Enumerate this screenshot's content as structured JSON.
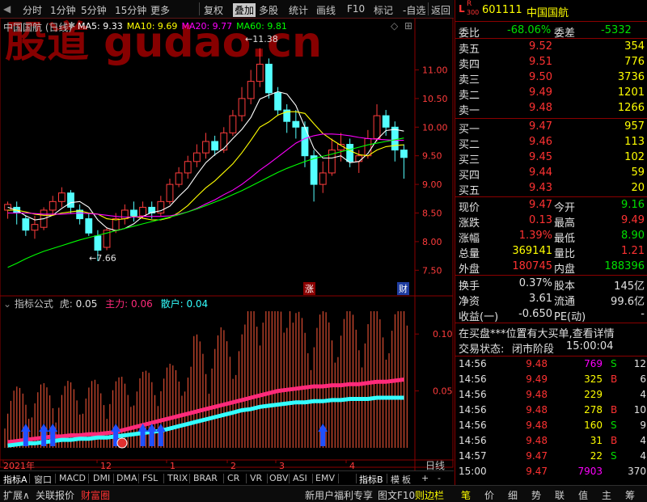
{
  "toolbar": {
    "items": [
      "分时",
      "1分钟",
      "5分钟",
      "15分钟",
      "更多",
      "复权",
      "叠加",
      "多股",
      "统计",
      "画线",
      "F10",
      "标记",
      "-自选",
      "返回"
    ],
    "active": "叠加"
  },
  "main_chart": {
    "title": "中国国航 (日线)",
    "ma": [
      {
        "label": "MA5: 9.33",
        "color": "#ffffff"
      },
      {
        "label": "MA10: 9.69",
        "color": "#ffff00"
      },
      {
        "label": "MA20: 9.77",
        "color": "#ff00ff"
      },
      {
        "label": "MA60: 9.81",
        "color": "#00ff00"
      }
    ],
    "watermark": "股道 gudao.cn",
    "high_label": "11.38",
    "low_label": "7.66",
    "price_ticks": [
      "11.00",
      "10.50",
      "10.00",
      "9.50",
      "9.00",
      "8.50",
      "8.00",
      "7.50"
    ],
    "tag_zhang": "涨",
    "tag_cai": "财"
  },
  "indicator": {
    "title": "指标公式",
    "hu_label": "虎:",
    "hu_value": "0.05",
    "zhuli_label": "主力:",
    "zhuli_value": "0.06",
    "sanhu_label": "散户:",
    "sanhu_value": "0.04",
    "ticks": [
      "0.10",
      "0.05"
    ],
    "colors": {
      "zhuli": "#ff2a7a",
      "sanhu": "#33ffff",
      "bars": "#ff5a3a"
    }
  },
  "chart_data": {
    "type": "line",
    "ylim": [
      7.25,
      11.6
    ],
    "candles": [
      [
        8.55,
        8.65,
        8.4,
        8.7
      ],
      [
        8.6,
        8.5,
        8.3,
        8.7
      ],
      [
        8.4,
        8.2,
        8.1,
        8.45
      ],
      [
        8.2,
        8.3,
        8.05,
        8.45
      ],
      [
        8.25,
        8.55,
        8.2,
        8.6
      ],
      [
        8.55,
        8.7,
        8.45,
        8.8
      ],
      [
        8.7,
        8.85,
        8.6,
        8.95
      ],
      [
        8.85,
        8.6,
        8.5,
        8.9
      ],
      [
        8.55,
        8.4,
        8.3,
        8.65
      ],
      [
        8.4,
        8.15,
        8.1,
        8.5
      ],
      [
        8.1,
        7.85,
        7.66,
        8.2
      ],
      [
        7.9,
        8.2,
        7.85,
        8.25
      ],
      [
        8.2,
        8.4,
        8.15,
        8.5
      ],
      [
        8.4,
        8.55,
        8.3,
        8.65
      ],
      [
        8.55,
        8.45,
        8.35,
        8.7
      ],
      [
        8.45,
        8.6,
        8.4,
        8.7
      ],
      [
        8.6,
        8.5,
        8.4,
        8.7
      ],
      [
        8.5,
        8.7,
        8.45,
        8.8
      ],
      [
        8.7,
        9.0,
        8.65,
        9.1
      ],
      [
        9.0,
        9.2,
        8.95,
        9.3
      ],
      [
        9.2,
        9.4,
        9.1,
        9.5
      ],
      [
        9.4,
        9.55,
        9.3,
        9.7
      ],
      [
        9.55,
        9.75,
        9.45,
        9.9
      ],
      [
        9.75,
        9.6,
        9.5,
        9.85
      ],
      [
        9.6,
        9.9,
        9.55,
        10.0
      ],
      [
        9.9,
        10.2,
        9.85,
        10.3
      ],
      [
        10.2,
        10.5,
        10.1,
        10.7
      ],
      [
        10.5,
        10.8,
        10.4,
        11.0
      ],
      [
        10.8,
        11.1,
        10.7,
        11.38
      ],
      [
        11.1,
        10.6,
        10.5,
        11.2
      ],
      [
        10.6,
        10.3,
        10.2,
        10.7
      ],
      [
        10.3,
        10.1,
        9.9,
        10.4
      ],
      [
        10.1,
        10.0,
        9.8,
        10.3
      ],
      [
        10.0,
        9.5,
        9.3,
        10.1
      ],
      [
        9.5,
        9.0,
        8.7,
        9.6
      ],
      [
        9.0,
        9.2,
        8.85,
        9.4
      ],
      [
        9.2,
        9.6,
        9.15,
        9.8
      ],
      [
        9.6,
        9.7,
        9.4,
        9.9
      ],
      [
        9.7,
        9.4,
        9.3,
        9.8
      ],
      [
        9.4,
        9.5,
        9.2,
        9.6
      ],
      [
        9.5,
        9.8,
        9.45,
        9.95
      ],
      [
        9.8,
        10.2,
        9.75,
        10.4
      ],
      [
        10.2,
        10.0,
        9.85,
        10.3
      ],
      [
        10.0,
        9.6,
        9.4,
        10.1
      ],
      [
        9.6,
        9.47,
        9.1,
        9.7
      ]
    ],
    "ma_series": [
      {
        "name": "MA5",
        "color": "#ffffff",
        "values": [
          8.6,
          8.55,
          8.45,
          8.38,
          8.4,
          8.46,
          8.58,
          8.68,
          8.7,
          8.6,
          8.38,
          8.24,
          8.19,
          8.23,
          8.31,
          8.44,
          8.51,
          8.54,
          8.62,
          8.79,
          8.94,
          9.17,
          9.38,
          9.52,
          9.63,
          9.8,
          9.96,
          10.17,
          10.49,
          10.56,
          10.62,
          10.58,
          10.38,
          10.0,
          9.63,
          9.46,
          9.46,
          9.5,
          9.38,
          9.4,
          9.54,
          9.78,
          9.94,
          9.96,
          9.93
        ]
      },
      {
        "name": "MA10",
        "color": "#ffff00",
        "values": [
          8.55,
          8.55,
          8.52,
          8.48,
          8.46,
          8.46,
          8.5,
          8.52,
          8.54,
          8.5,
          8.48,
          8.4,
          8.38,
          8.4,
          8.44,
          8.41,
          8.38,
          8.38,
          8.42,
          8.51,
          8.63,
          8.79,
          8.94,
          9.06,
          9.21,
          9.36,
          9.55,
          9.77,
          10.0,
          10.09,
          10.21,
          10.27,
          10.27,
          10.24,
          10.06,
          9.89,
          9.78,
          9.68,
          9.59,
          9.52,
          9.5,
          9.6,
          9.66,
          9.68,
          9.69
        ]
      },
      {
        "name": "MA20",
        "color": "#ff00ff",
        "values": [
          8.5,
          8.5,
          8.5,
          8.49,
          8.48,
          8.48,
          8.48,
          8.49,
          8.5,
          8.49,
          8.48,
          8.46,
          8.44,
          8.43,
          8.43,
          8.44,
          8.44,
          8.44,
          8.45,
          8.48,
          8.52,
          8.58,
          8.66,
          8.73,
          8.82,
          8.9,
          9.0,
          9.12,
          9.25,
          9.36,
          9.48,
          9.6,
          9.72,
          9.8,
          9.85,
          9.88,
          9.88,
          9.87,
          9.85,
          9.82,
          9.8,
          9.79,
          9.78,
          9.77,
          9.77
        ]
      },
      {
        "name": "MA60",
        "color": "#00ff00",
        "values": [
          7.55,
          7.62,
          7.7,
          7.77,
          7.83,
          7.88,
          7.93,
          7.98,
          8.03,
          8.07,
          8.11,
          8.15,
          8.19,
          8.23,
          8.27,
          8.31,
          8.35,
          8.39,
          8.43,
          8.47,
          8.52,
          8.57,
          8.63,
          8.69,
          8.75,
          8.82,
          8.89,
          8.97,
          9.05,
          9.13,
          9.21,
          9.28,
          9.34,
          9.4,
          9.45,
          9.49,
          9.53,
          9.57,
          9.61,
          9.65,
          9.69,
          9.72,
          9.75,
          9.78,
          9.81
        ]
      }
    ],
    "indicator_ylim": [
      0,
      0.125
    ],
    "zhuli": [
      0.005,
      0.006,
      0.007,
      0.008,
      0.009,
      0.01,
      0.01,
      0.011,
      0.011,
      0.012,
      0.012,
      0.013,
      0.014,
      0.016,
      0.018,
      0.02,
      0.022,
      0.024,
      0.026,
      0.028,
      0.03,
      0.032,
      0.034,
      0.036,
      0.038,
      0.04,
      0.042,
      0.044,
      0.046,
      0.048,
      0.05,
      0.051,
      0.052,
      0.053,
      0.054,
      0.054,
      0.055,
      0.055,
      0.056,
      0.056,
      0.057,
      0.058,
      0.058,
      0.059,
      0.06
    ],
    "sanhu": [
      0.002,
      0.003,
      0.004,
      0.004,
      0.005,
      0.006,
      0.007,
      0.007,
      0.008,
      0.008,
      0.009,
      0.009,
      0.01,
      0.011,
      0.012,
      0.013,
      0.014,
      0.015,
      0.017,
      0.019,
      0.021,
      0.023,
      0.025,
      0.027,
      0.029,
      0.031,
      0.033,
      0.034,
      0.036,
      0.037,
      0.038,
      0.039,
      0.04,
      0.04,
      0.041,
      0.041,
      0.042,
      0.042,
      0.043,
      0.043,
      0.043,
      0.044,
      0.044,
      0.044,
      0.044
    ],
    "x_labels": [
      "2021年",
      "12",
      "1",
      "2",
      "3",
      "4"
    ],
    "right_label": "日线"
  },
  "bottom_tabs": [
    "指标A",
    "窗口",
    "MACD",
    "DMI",
    "DMA",
    "FSL",
    "TRIX",
    "BRAR",
    "CR",
    "VR",
    "OBV",
    "ASI",
    "EMV",
    "指标B",
    "模",
    "板",
    "+",
    "-"
  ],
  "status_bar": {
    "left": [
      "扩展∧",
      "关联报价",
      "财富圈"
    ],
    "mid": [
      "新用户福利专享",
      "图文F10",
      "则边栏"
    ],
    "right": [
      "笔",
      "价",
      "细",
      "势",
      "联",
      "值",
      "主",
      "筹"
    ]
  },
  "quote": {
    "code": "601111",
    "name": "中国国航",
    "weibi_label": "委比",
    "weibi_value": "-68.06%",
    "weicha_label": "委差",
    "weicha_value": "-5332",
    "asks": [
      {
        "label": "卖五",
        "price": "9.52",
        "vol": "354"
      },
      {
        "label": "卖四",
        "price": "9.51",
        "vol": "776"
      },
      {
        "label": "卖三",
        "price": "9.50",
        "vol": "3736"
      },
      {
        "label": "卖二",
        "price": "9.49",
        "vol": "1201"
      },
      {
        "label": "卖一",
        "price": "9.48",
        "vol": "1266"
      }
    ],
    "bids": [
      {
        "label": "买一",
        "price": "9.47",
        "vol": "957"
      },
      {
        "label": "买二",
        "price": "9.46",
        "vol": "113"
      },
      {
        "label": "买三",
        "price": "9.45",
        "vol": "102"
      },
      {
        "label": "买四",
        "price": "9.44",
        "vol": "59"
      },
      {
        "label": "买五",
        "price": "9.43",
        "vol": "20"
      }
    ],
    "stats": [
      {
        "l1": "现价",
        "v1": "9.47",
        "c1": "#ff3232",
        "l2": "今开",
        "v2": "9.16",
        "c2": "#00e000"
      },
      {
        "l1": "涨跌",
        "v1": "0.13",
        "c1": "#ff3232",
        "l2": "最高",
        "v2": "9.49",
        "c2": "#ff3232"
      },
      {
        "l1": "涨幅",
        "v1": "1.39%",
        "c1": "#ff3232",
        "l2": "最低",
        "v2": "8.90",
        "c2": "#00e000"
      },
      {
        "l1": "总量",
        "v1": "369141",
        "c1": "#ffff00",
        "l2": "量比",
        "v2": "1.21",
        "c2": "#ff3232"
      },
      {
        "l1": "外盘",
        "v1": "180745",
        "c1": "#ff3232",
        "l2": "内盘",
        "v2": "188396",
        "c2": "#00e000"
      }
    ],
    "stats2": [
      {
        "l1": "换手",
        "v1": "0.37%",
        "l2": "股本",
        "v2": "145亿"
      },
      {
        "l1": "净资",
        "v1": "3.61",
        "l2": "流通",
        "v2": "99.6亿"
      },
      {
        "l1": "收益(一)",
        "v1": "-0.650",
        "l2": "PE(动)",
        "v2": "-"
      }
    ],
    "notice": "在买盘***位置有大买单,查看详情",
    "trade_status_label": "交易状态:",
    "trade_status_value": "闭市阶段",
    "trade_status_time": "15:00:04",
    "ticks": [
      {
        "t": "14:56",
        "p": "9.48",
        "v": "769",
        "s": "S",
        "n": "12",
        "vc": "#ff00ff"
      },
      {
        "t": "14:56",
        "p": "9.49",
        "v": "325",
        "s": "B",
        "n": "6",
        "vc": "#ffff00"
      },
      {
        "t": "14:56",
        "p": "9.48",
        "v": "229",
        "s": "",
        "n": "4",
        "vc": "#ffff00"
      },
      {
        "t": "14:56",
        "p": "9.48",
        "v": "278",
        "s": "B",
        "n": "10",
        "vc": "#ffff00"
      },
      {
        "t": "14:56",
        "p": "9.48",
        "v": "160",
        "s": "S",
        "n": "9",
        "vc": "#ffff00"
      },
      {
        "t": "14:56",
        "p": "9.48",
        "v": "31",
        "s": "B",
        "n": "4",
        "vc": "#ffff00"
      },
      {
        "t": "14:57",
        "p": "9.47",
        "v": "22",
        "s": "S",
        "n": "4",
        "vc": "#ffff00"
      },
      {
        "t": "15:00",
        "p": "9.47",
        "v": "7903",
        "s": "",
        "n": "370",
        "vc": "#ff00ff"
      }
    ]
  }
}
